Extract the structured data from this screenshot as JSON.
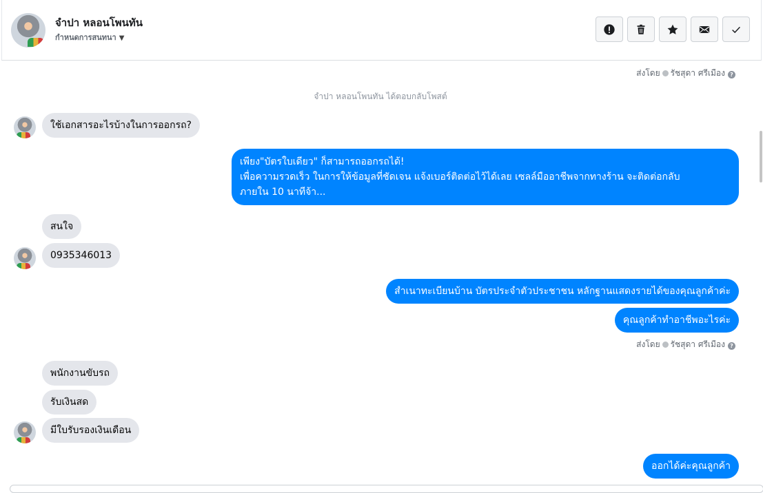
{
  "header": {
    "contact_name": "จำปา หลอนโพนทัน",
    "subtitle": "กำหนดการสนทนา",
    "actions": [
      {
        "name": "report-button",
        "icon": "alert-icon"
      },
      {
        "name": "delete-button",
        "icon": "trash-icon"
      },
      {
        "name": "star-button",
        "icon": "star-icon"
      },
      {
        "name": "mark-unread-button",
        "icon": "envelope-icon"
      },
      {
        "name": "mark-done-button",
        "icon": "check-icon"
      }
    ]
  },
  "thread": {
    "sent_by_1": {
      "prefix": "ส่งโดย",
      "agent": "รัชสุดา ศรีเมือง",
      "help": "?"
    },
    "reply_note": "จำปา หลอนโพนทัน ได้ตอบกลับโพสต์",
    "msg_in_1": "ใช้เอกสารอะไรบ้างในการออกรถ?",
    "msg_out_1_line1": "เพียง\"บัตรใบเดียว\" ก็สามารถออกรถได้!",
    "msg_out_1_line2": "เพื่อความรวดเร็ว ในการให้ข้อมูลที่ชัดเจน แจ้งเบอร์ติดต่อไว้ได้เลย เซลล์มืออาชีพจากทางร้าน จะติดต่อกลับ",
    "msg_out_1_line3": "ภายใน 10 นาทีจ้า...",
    "msg_in_2": "สนใจ",
    "msg_in_3": "0935346013",
    "msg_out_2": "สำเนาทะเบียนบ้าน บัตรประจำตัวประชาชน หลักฐานแสดงรายได้ของคุณลูกค้าค่ะ",
    "msg_out_3": "คุณลูกค้าทำอาชีพอะไรค่ะ",
    "sent_by_2": {
      "prefix": "ส่งโดย",
      "agent": "รัชสุดา ศรีเมือง",
      "help": "?"
    },
    "msg_in_4": "พนักงานขับรถ",
    "msg_in_5": "รับเงินสด",
    "msg_in_6": "มีใบรับรองเงินเดือน",
    "msg_out_4": "ออกได้ค่ะคุณลูกค้า"
  },
  "colors": {
    "outgoing_bubble": "#0084ff",
    "incoming_bubble": "#e4e6eb",
    "muted_text": "#606770"
  }
}
